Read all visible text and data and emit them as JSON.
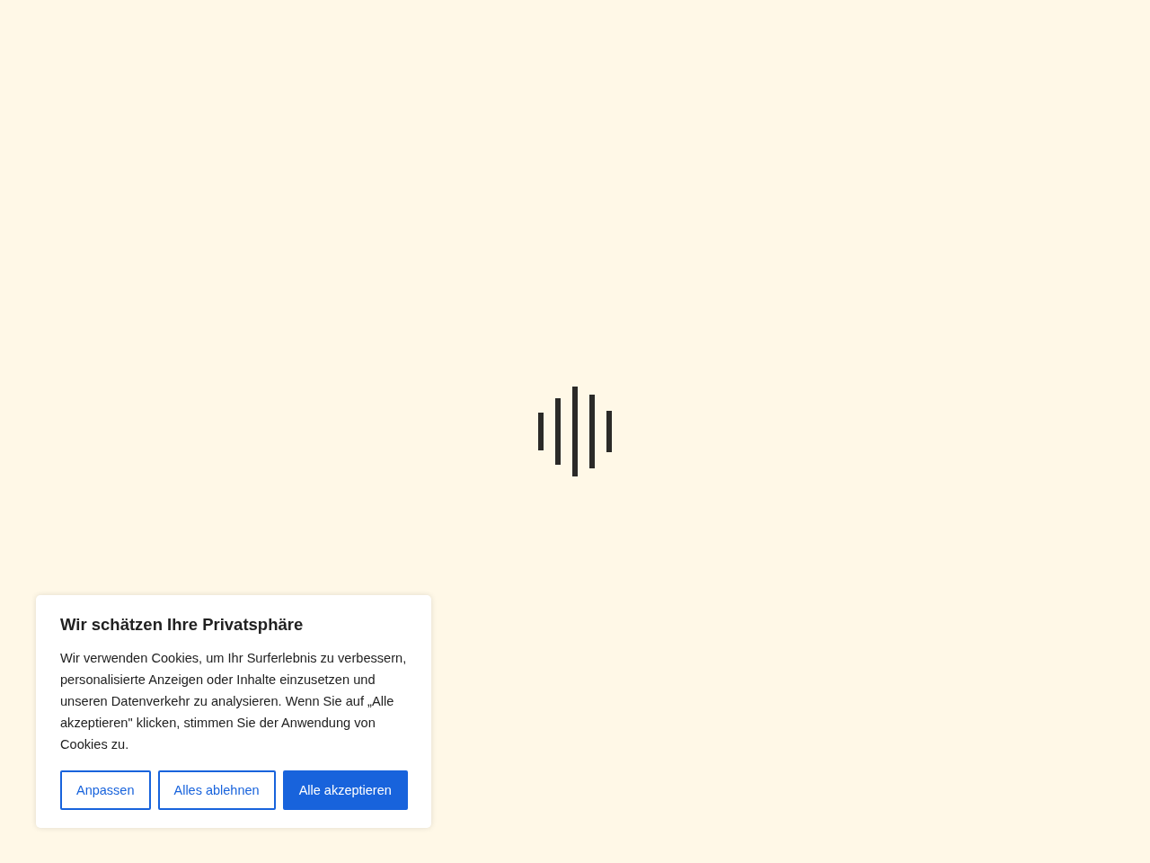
{
  "cookie_banner": {
    "title": "Wir schätzen Ihre Privatsphäre",
    "text": "Wir verwenden Cookies, um Ihr Surferlebnis zu verbessern, personalisierte Anzeigen oder Inhalte einzusetzen und unseren Datenverkehr zu analysieren. Wenn Sie auf „Alle akzeptieren\" klicken, stimmen Sie der Anwendung von Cookies zu.",
    "buttons": [
      {
        "label": "Anpassen",
        "kind": "outline"
      },
      {
        "label": "Alles ablehnen",
        "kind": "outline"
      },
      {
        "label": "Alle akzeptieren",
        "kind": "primary"
      }
    ]
  }
}
